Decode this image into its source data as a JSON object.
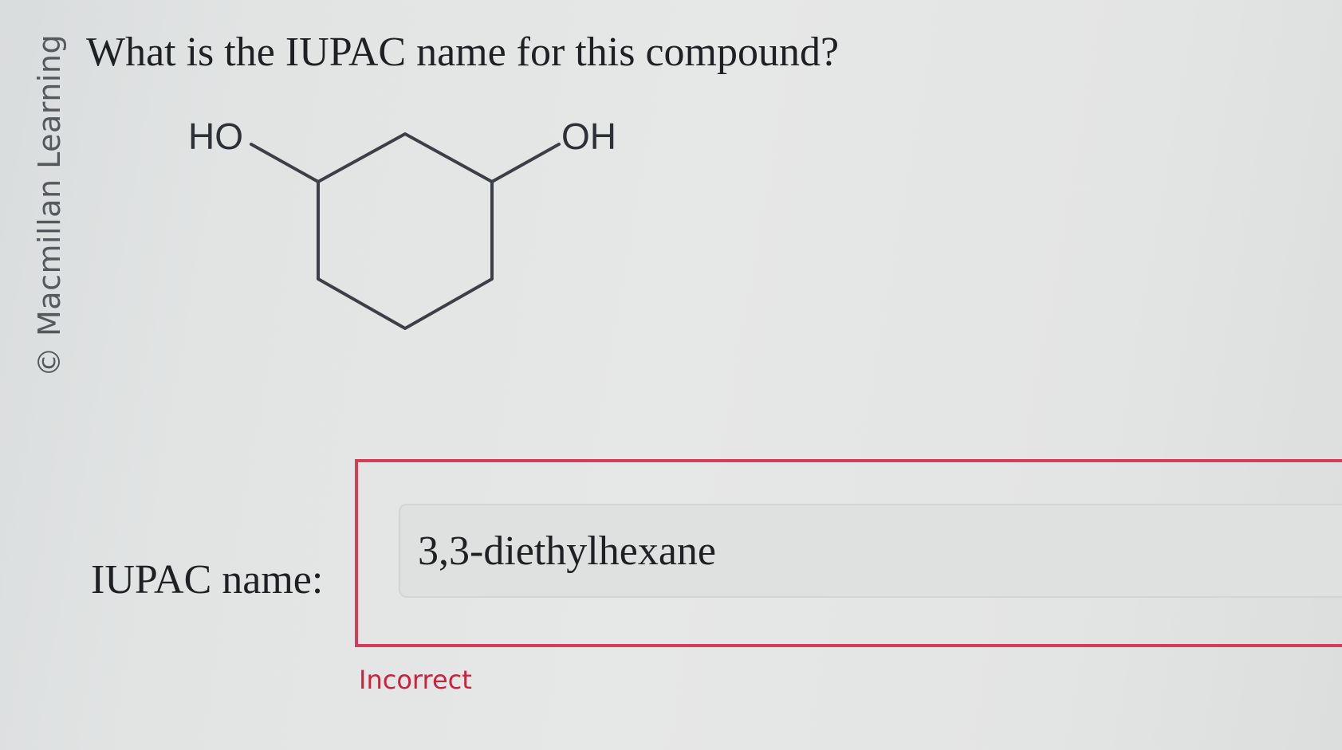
{
  "watermark": "© Macmillan Learning",
  "question": "What is the IUPAC name for this compound?",
  "structure": {
    "left_substituent": "HO",
    "right_substituent": "OH"
  },
  "answer": {
    "label": "IUPAC name:",
    "value": "3,3-diethylhexane",
    "status": "Incorrect"
  },
  "colors": {
    "error_border": "#d53c57",
    "error_text": "#c7243e"
  }
}
